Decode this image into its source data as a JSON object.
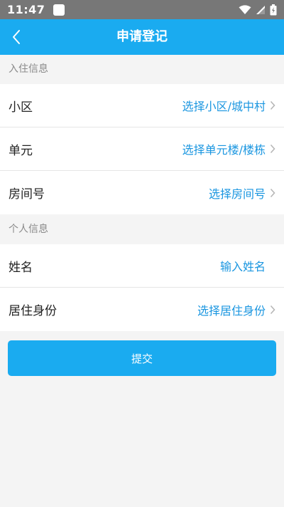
{
  "status_bar": {
    "time": "11:47"
  },
  "header": {
    "title": "申请登记",
    "back_icon": "chevron-left-icon"
  },
  "sections": [
    {
      "title": "入住信息",
      "rows": [
        {
          "label": "小区",
          "value": "选择小区/城中村",
          "chevron": true
        },
        {
          "label": "单元",
          "value": "选择单元楼/楼栋",
          "chevron": true
        },
        {
          "label": "房间号",
          "value": "选择房间号",
          "chevron": true
        }
      ]
    },
    {
      "title": "个人信息",
      "rows": [
        {
          "label": "姓名",
          "value": "输入姓名",
          "chevron": false
        },
        {
          "label": "居住身份",
          "value": "选择居住身份",
          "chevron": true
        }
      ]
    }
  ],
  "submit_label": "提交",
  "colors": {
    "accent": "#1aabf0",
    "link": "#1a96e0",
    "status_bar": "#777777"
  }
}
